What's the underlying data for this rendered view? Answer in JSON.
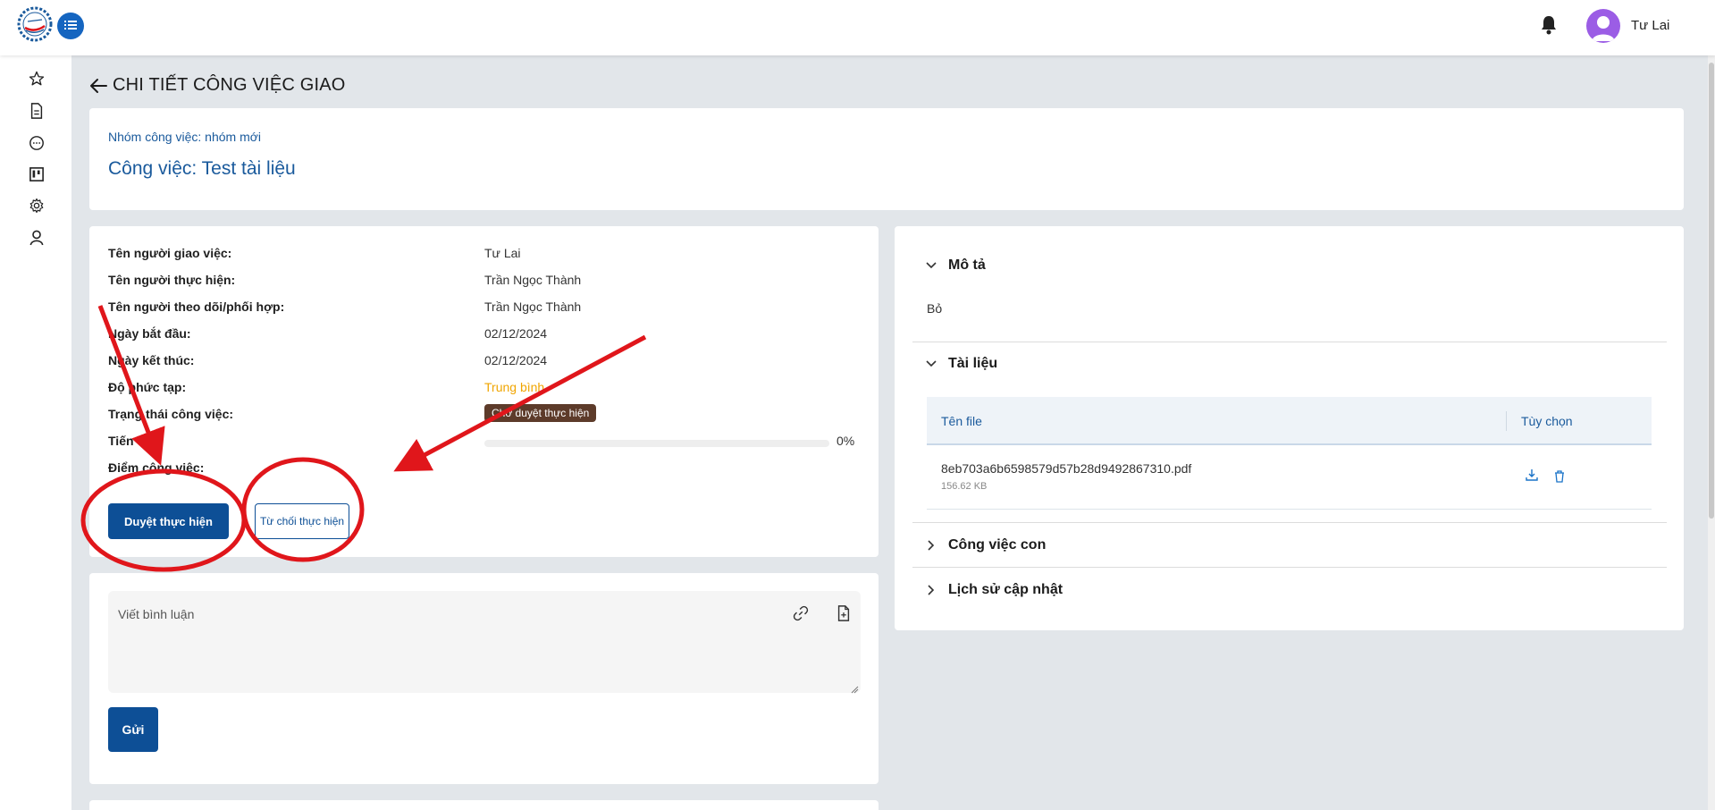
{
  "user": {
    "name": "Tư Lai"
  },
  "page": {
    "title": "CHI TIẾT CÔNG VIỆC GIAO"
  },
  "header": {
    "group_label": "Nhóm công việc: nhóm mới",
    "task_title": "Công việc: Test tài liệu"
  },
  "info": {
    "rows": [
      {
        "label": "Tên người giao việc:",
        "value": "Tư Lai"
      },
      {
        "label": "Tên người thực hiện:",
        "value": "Trần Ngọc Thành"
      },
      {
        "label": "Tên người theo dõi/phối hợp:",
        "value": "Trần Ngọc Thành"
      },
      {
        "label": "Ngày bắt đầu:",
        "value": "02/12/2024"
      },
      {
        "label": "Ngày kết thúc:",
        "value": "02/12/2024"
      },
      {
        "label": "Độ phức tạp:",
        "value": "Trung bình"
      },
      {
        "label": "Trạng thái công việc:",
        "value": "Chờ duyệt thực hiện"
      },
      {
        "label": "Tiến độ:",
        "value": "0%"
      },
      {
        "label": "Điểm công việc:",
        "value": ""
      }
    ],
    "progress_fraction": 0,
    "approve_label": "Duyệt thực hiện",
    "reject_label": "Từ chối thực hiện"
  },
  "comment": {
    "placeholder": "Viết bình luận",
    "send_label": "Gửi"
  },
  "right": {
    "description_title": "Mô tả",
    "description_text": "Bỏ",
    "documents_title": "Tài liệu",
    "table": {
      "col_name": "Tên file",
      "col_options": "Tùy chọn",
      "files": [
        {
          "name": "8eb703a6b6598579d57b28d9492867310.pdf",
          "size": "156.62 KB"
        }
      ]
    },
    "subtasks_title": "Công việc con",
    "history_title": "Lịch sử cập nhật"
  },
  "colors": {
    "primary": "#0d4f96",
    "accent_blue": "#1a5a9c",
    "medium_level": "#f0a500",
    "status_badge": "#5d3b2a",
    "annotation_red": "#e0161b",
    "avatar": "#9b5de5"
  },
  "icons": [
    "logo-icon",
    "menu-icon",
    "bell-icon",
    "user-avatar-icon",
    "star-icon",
    "document-icon",
    "chat-icon",
    "board-icon",
    "gear-icon",
    "person-icon",
    "arrow-left-icon",
    "link-icon",
    "file-add-icon",
    "download-icon",
    "trash-icon",
    "chevron-down-icon",
    "chevron-right-icon"
  ]
}
